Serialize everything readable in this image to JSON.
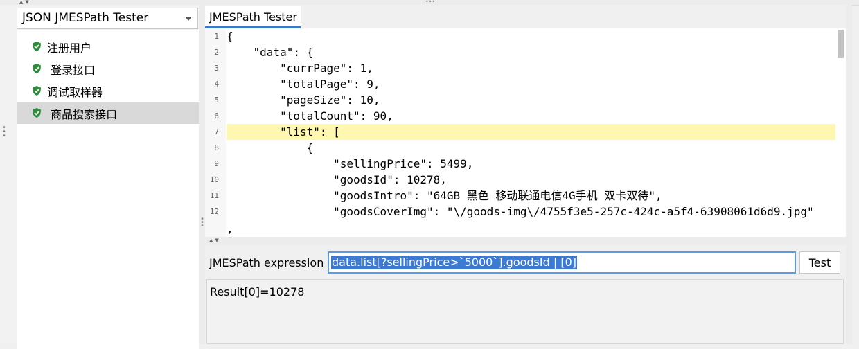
{
  "sampler_selector": {
    "selected": "JSON JMESPath Tester"
  },
  "tree": {
    "items": [
      {
        "label": "注册用户",
        "selected": false
      },
      {
        "label": " 登录接口",
        "selected": false
      },
      {
        "label": "调试取样器",
        "selected": false
      },
      {
        "label": " 商品搜索接口",
        "selected": true
      }
    ]
  },
  "tab": {
    "label": "JMESPath Tester"
  },
  "editor": {
    "line_numbers": [
      "1",
      "2",
      "3",
      "4",
      "5",
      "6",
      "7",
      "8",
      "9",
      "10",
      "11",
      "12"
    ],
    "lines": [
      "{",
      "    \"data\": {",
      "        \"currPage\": 1,",
      "        \"totalPage\": 9,",
      "        \"pageSize\": 10,",
      "        \"totalCount\": 90,",
      "        \"list\": [",
      "            {",
      "                \"sellingPrice\": 5499,",
      "                \"goodsId\": 10278,",
      "                \"goodsIntro\": \"64GB 黑色 移动联通电信4G手机 双卡双待\",",
      "                \"goodsCoverImg\": \"\\/goods-img\\/4755f3e5-257c-424c-a5f4-63908061d6d9.jpg\"",
      ","
    ],
    "highlighted_line": 7
  },
  "expression": {
    "label": "JMESPath expression",
    "value": "data.list[?sellingPrice>`5000`].goodsId | [0]"
  },
  "test_button": {
    "label": "Test"
  },
  "result": {
    "text": "Result[0]=10278"
  },
  "colors": {
    "accent": "#3c78c8",
    "selection": "#3d7ad4",
    "highlight": "#fdf7b0",
    "check_icon": "#2e8b3a"
  }
}
